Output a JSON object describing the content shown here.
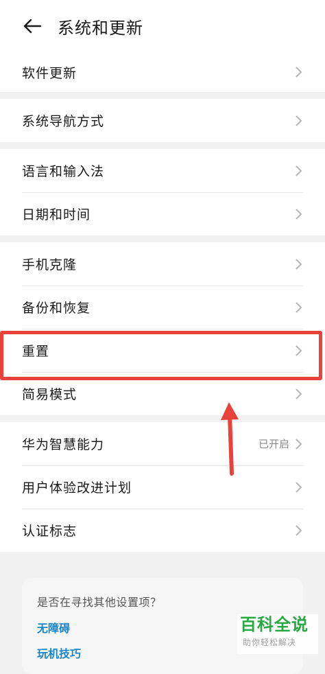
{
  "header": {
    "title": "系统和更新",
    "back_icon": "back-arrow-icon"
  },
  "groups": [
    {
      "items": [
        {
          "label": "软件更新"
        }
      ]
    },
    {
      "items": [
        {
          "label": "系统导航方式"
        }
      ]
    },
    {
      "items": [
        {
          "label": "语言和输入法"
        },
        {
          "label": "日期和时间"
        }
      ]
    },
    {
      "items": [
        {
          "label": "手机克隆"
        },
        {
          "label": "备份和恢复"
        },
        {
          "label": "重置"
        },
        {
          "label": "简易模式"
        }
      ]
    },
    {
      "items": [
        {
          "label": "华为智慧能力",
          "value": "已开启"
        },
        {
          "label": "用户体验改进计划"
        },
        {
          "label": "认证标志"
        }
      ]
    }
  ],
  "card": {
    "question": "是否在寻找其他设置项？",
    "links": [
      "无障碍",
      "玩机技巧"
    ]
  },
  "watermark": {
    "title": "百科全说",
    "subtitle": "助你轻松解决"
  },
  "colors": {
    "highlight": "#e8423a",
    "link": "#1a84c8",
    "watermark": "#22a63d"
  }
}
